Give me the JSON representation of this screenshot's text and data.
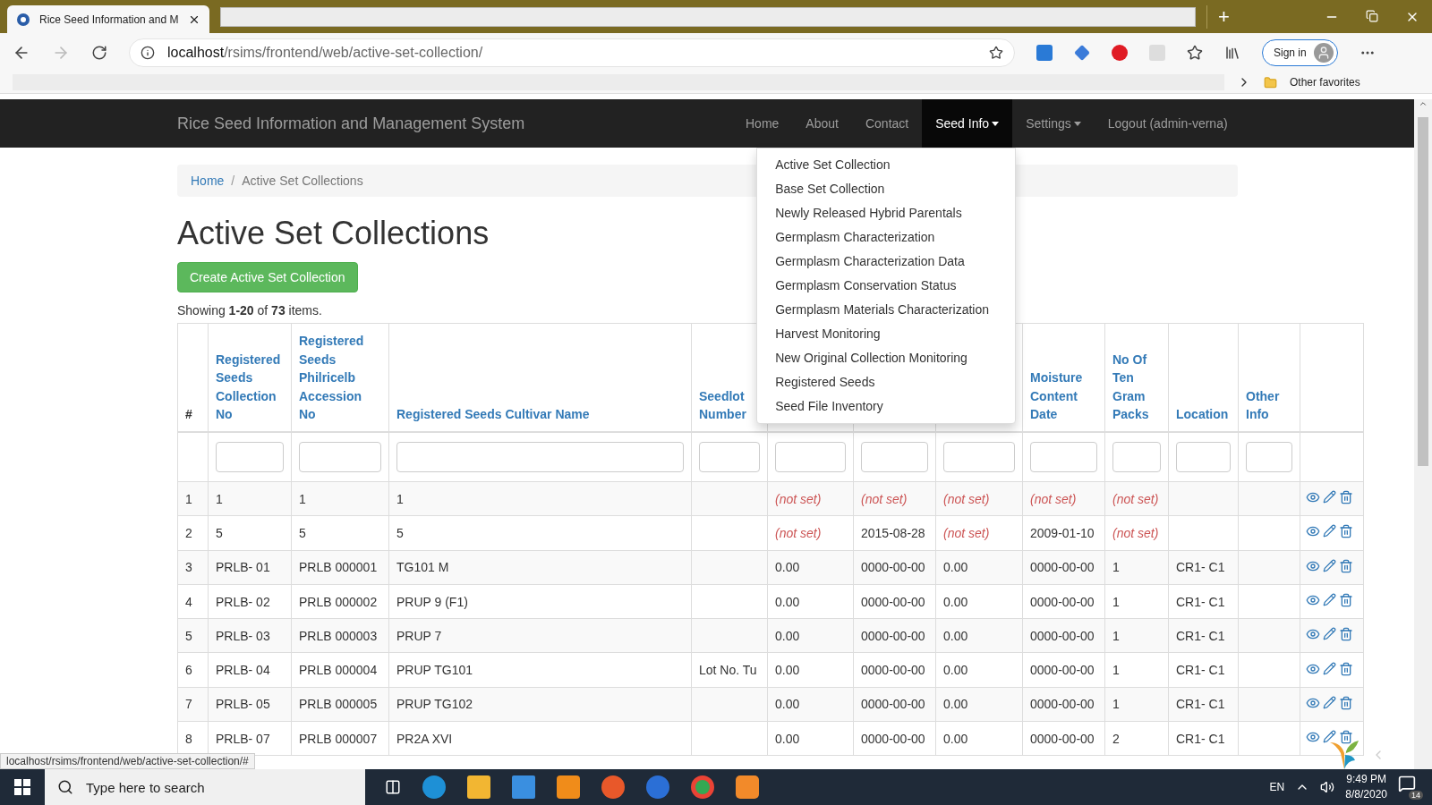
{
  "browser": {
    "tab": {
      "title": "Rice Seed Information and M",
      "selected": true
    },
    "new_tab": "+",
    "url": {
      "host": "localhost",
      "path": "/rsims/frontend/web/active-set-collection/"
    },
    "sign_in": "Sign in",
    "favorites": "Other favorites"
  },
  "navbar": {
    "brand": "Rice Seed Information and Management System",
    "items": [
      {
        "label": "Home",
        "selected": false,
        "dropdown": false
      },
      {
        "label": "About",
        "selected": false,
        "dropdown": false
      },
      {
        "label": "Contact",
        "selected": false,
        "dropdown": false
      },
      {
        "label": "Seed Info",
        "selected": true,
        "dropdown": true,
        "menu": [
          "Active Set Collection",
          "Base Set Collection",
          "Newly Released Hybrid Parentals",
          "Germplasm Characterization",
          "Germplasm Characterization Data",
          "Germplasm Conservation Status",
          "Germplasm Materials Characterization",
          "Harvest Monitoring",
          "New Original Collection Monitoring",
          "Registered Seeds",
          "Seed File Inventory"
        ]
      },
      {
        "label": "Settings",
        "selected": false,
        "dropdown": true
      },
      {
        "label": "Logout (admin-verna)",
        "selected": false,
        "dropdown": false
      }
    ]
  },
  "breadcrumb": {
    "separator": "/",
    "items": [
      {
        "label": "Home",
        "link": true
      },
      {
        "label": "Active Set Collections",
        "link": false
      }
    ]
  },
  "heading": "Active Set Collections",
  "create_button": "Create Active Set Collection",
  "summary": "Showing **1-20** of **73** items.",
  "table": {
    "columns": [
      {
        "label": "#",
        "sortable": false
      },
      {
        "label": "Registered Seeds Collection No",
        "sortable": true
      },
      {
        "label": "Registered Seeds Philricelb Accession No",
        "sortable": true
      },
      {
        "label": "Registered Seeds Cultivar Name",
        "sortable": true
      },
      {
        "label": "Seedlot Number",
        "sortable": true
      },
      null,
      null,
      null,
      {
        "label": "Moisture Content Date",
        "sortable": true
      },
      {
        "label": "No Of Ten Gram Packs",
        "sortable": true
      },
      {
        "label": "Location",
        "sortable": true
      },
      {
        "label": "Other Info",
        "sortable": true
      }
    ],
    "rows": [
      {
        "cells": [
          "1",
          "1",
          "1",
          "1",
          null,
          {
            "text": "(not set)",
            "unset": true
          },
          {
            "text": "(not set)",
            "unset": true
          },
          {
            "text": "(not set)",
            "unset": true
          },
          {
            "text": "(not set)",
            "unset": true
          },
          {
            "text": "(not set)",
            "unset": true
          },
          null,
          null
        ]
      },
      {
        "cells": [
          "2",
          "5",
          "5",
          "5",
          null,
          {
            "text": "(not set)",
            "unset": true
          },
          "2015-08-28",
          {
            "text": "(not set)",
            "unset": true
          },
          "2009-01-10",
          {
            "text": "(not set)",
            "unset": true
          },
          null,
          null
        ]
      },
      {
        "cells": [
          "3",
          "PRLB- 01",
          "PRLB 000001",
          "TG101 M",
          null,
          "0.00",
          "0000-00-00",
          "0.00",
          "0000-00-00",
          "1",
          "CR1- C1",
          null
        ]
      },
      {
        "cells": [
          "4",
          "PRLB- 02",
          "PRLB 000002",
          "PRUP 9 (F1)",
          null,
          "0.00",
          "0000-00-00",
          "0.00",
          "0000-00-00",
          "1",
          "CR1- C1",
          null
        ]
      },
      {
        "cells": [
          "5",
          "PRLB- 03",
          "PRLB 000003",
          "PRUP 7",
          null,
          "0.00",
          "0000-00-00",
          "0.00",
          "0000-00-00",
          "1",
          "CR1- C1",
          null
        ]
      },
      {
        "cells": [
          "6",
          "PRLB- 04",
          "PRLB 000004",
          "PRUP TG101",
          "Lot No. Tu",
          "0.00",
          "0000-00-00",
          "0.00",
          "0000-00-00",
          "1",
          "CR1- C1",
          null
        ]
      },
      {
        "cells": [
          "7",
          "PRLB- 05",
          "PRLB 000005",
          "PRUP TG102",
          null,
          "0.00",
          "0000-00-00",
          "0.00",
          "0000-00-00",
          "1",
          "CR1- C1",
          null
        ]
      },
      {
        "cells": [
          "8",
          "PRLB- 07",
          "PRLB 000007",
          "PR2A XVI",
          null,
          "0.00",
          "0000-00-00",
          "0.00",
          "0000-00-00",
          "2",
          "CR1- C1",
          null
        ]
      }
    ]
  },
  "status_link": "localhost/rsims/frontend/web/active-set-collection/#",
  "taskbar": {
    "search_placeholder": "Type here to search",
    "language": "EN",
    "time": "9:49 PM",
    "date": "8/8/2020",
    "notifications": "14"
  }
}
